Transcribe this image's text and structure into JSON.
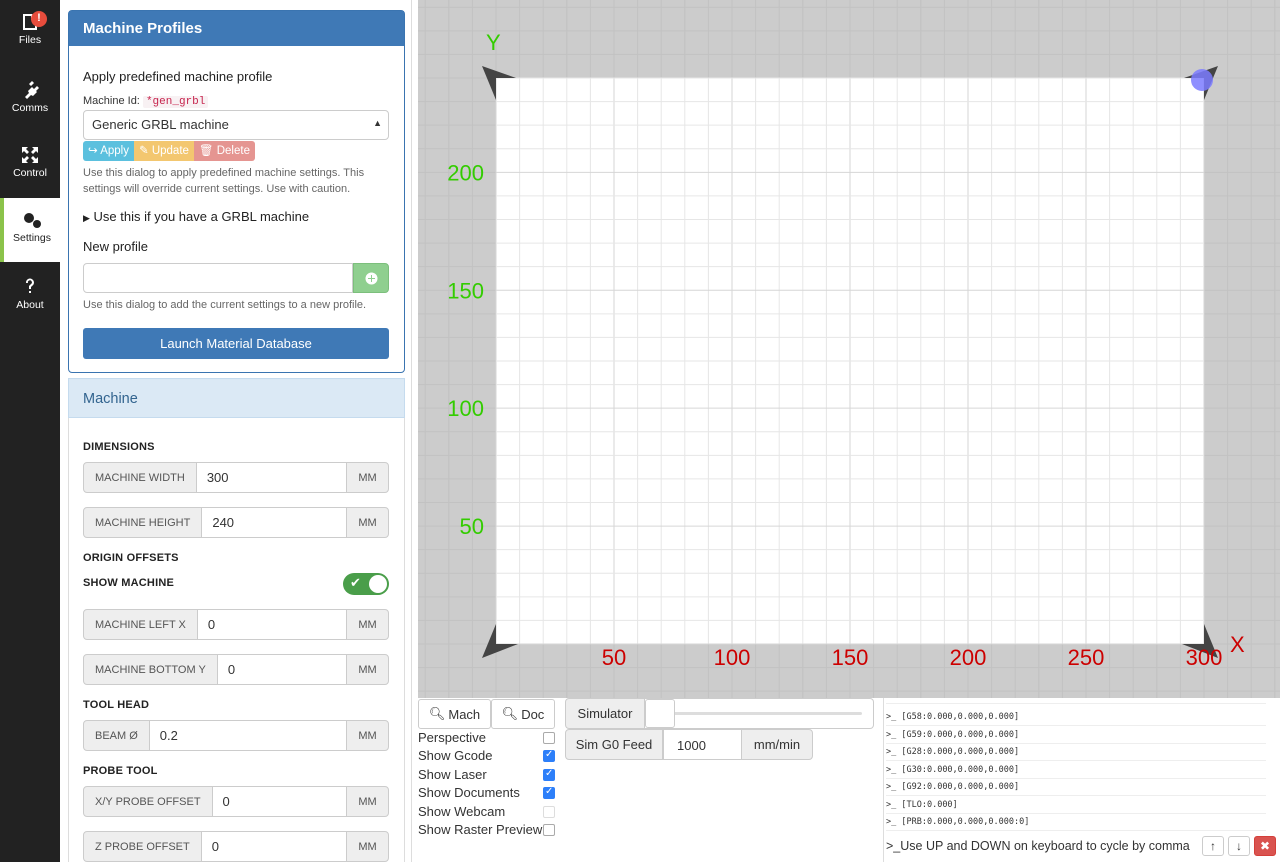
{
  "nav": {
    "items": [
      {
        "label": "Files",
        "badge": "!"
      },
      {
        "label": "Comms"
      },
      {
        "label": "Control"
      },
      {
        "label": "Settings"
      },
      {
        "label": "About"
      }
    ]
  },
  "profiles": {
    "title": "Machine Profiles",
    "apply_heading": "Apply predefined machine profile",
    "machine_id_label": "Machine Id:",
    "machine_id_code": "*gen_grbl",
    "selected_machine": "Generic GRBL machine",
    "apply_btn": "Apply",
    "update_btn": "Update",
    "delete_btn": "Delete",
    "apply_help": "Use this dialog to apply predefined machine settings. This settings will override current settings. Use with caution.",
    "grbl_summary": "Use this if you have a GRBL machine",
    "new_profile_label": "New profile",
    "new_profile_value": "",
    "new_profile_help": "Use this dialog to add the current settings to a new profile.",
    "launch_btn": "Launch Material Database"
  },
  "machine": {
    "title": "Machine",
    "dimensions_label": "DIMENSIONS",
    "width_label": "MACHINE WIDTH",
    "width_value": "300",
    "height_label": "MACHINE HEIGHT",
    "height_value": "240",
    "origin_label": "ORIGIN OFFSETS",
    "show_machine_label": "SHOW MACHINE",
    "show_machine_on": true,
    "left_x_label": "MACHINE LEFT X",
    "left_x_value": "0",
    "bottom_y_label": "MACHINE BOTTOM Y",
    "bottom_y_value": "0",
    "tool_head_label": "TOOL HEAD",
    "beam_label": "BEAM Ø",
    "beam_value": "0.2",
    "probe_label": "PROBE TOOL",
    "xy_probe_label": "X/Y PROBE OFFSET",
    "xy_probe_value": "0",
    "z_probe_label": "Z PROBE OFFSET",
    "z_probe_value": "0",
    "unit": "MM"
  },
  "workspace": {
    "x_axis_label": "X",
    "y_axis_label": "Y",
    "x_ticks": [
      "50",
      "100",
      "150",
      "200",
      "250",
      "300"
    ],
    "y_ticks": [
      "200",
      "150",
      "100",
      "50"
    ],
    "grid_color": "#e6e6e6",
    "x_color": "#cc0000",
    "y_color": "#33cc00"
  },
  "controls": {
    "mach_btn": "Mach",
    "doc_btn": "Doc",
    "simulator_label": "Simulator",
    "sim_feed_label": "Sim G0 Feed",
    "sim_feed_value": "1000",
    "sim_feed_unit": "mm/min",
    "options": [
      {
        "label": "Perspective",
        "checked": false
      },
      {
        "label": "Show Gcode",
        "checked": true
      },
      {
        "label": "Show Laser",
        "checked": true
      },
      {
        "label": "Show Documents",
        "checked": true
      },
      {
        "label": "Show Webcam",
        "checked": false
      },
      {
        "label": "Show Raster Preview",
        "checked": false
      }
    ]
  },
  "console": {
    "lines": [
      "[G58:0.000,0.000,0.000]",
      "[G59:0.000,0.000,0.000]",
      "[G28:0.000,0.000,0.000]",
      "[G30:0.000,0.000,0.000]",
      "[G92:0.000,0.000,0.000]",
      "[TLO:0.000]",
      "[PRB:0.000,0.000,0.000:0]"
    ],
    "prompt": ">_",
    "placeholder": "Use UP and DOWN on keyboard to cycle by comma",
    "up_btn": "🡑",
    "down_btn": "🡓",
    "clear_btn": "✖"
  }
}
